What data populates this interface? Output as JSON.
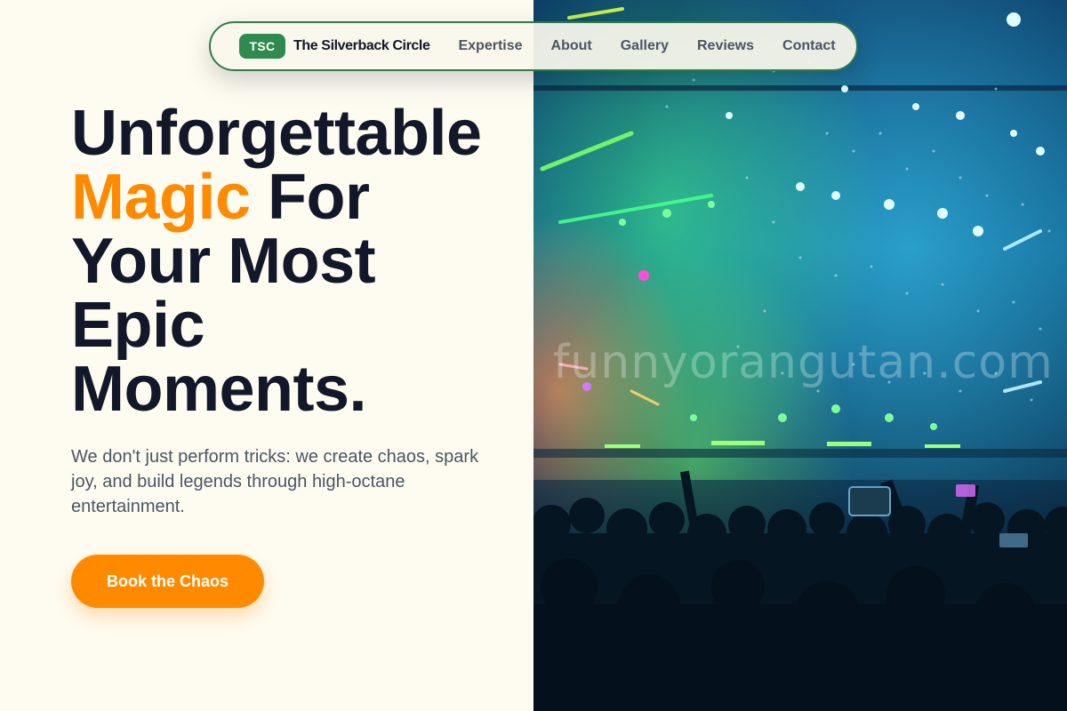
{
  "nav": {
    "logo": "TSC",
    "brand": "The Silverback Circle",
    "links": [
      "Expertise",
      "About",
      "Gallery",
      "Reviews",
      "Contact"
    ]
  },
  "hero": {
    "line1": "Unforgettable",
    "accent_word": "Magic",
    "line2_rest": " For",
    "line3": "Your Most",
    "line4": "Epic",
    "line5": "Moments.",
    "subtext": "We don't just perform tricks: we create chaos, spark joy, and build legends through high-octane entertainment.",
    "cta_label": "Book the Chaos"
  },
  "image": {
    "watermark": "funnyorangutan.com",
    "description_icon": "concert-crowd-image"
  },
  "colors": {
    "accent": "#ff8a00",
    "brand_green": "#2e8a4f",
    "heading": "#121829",
    "background": "#fefcf1"
  }
}
